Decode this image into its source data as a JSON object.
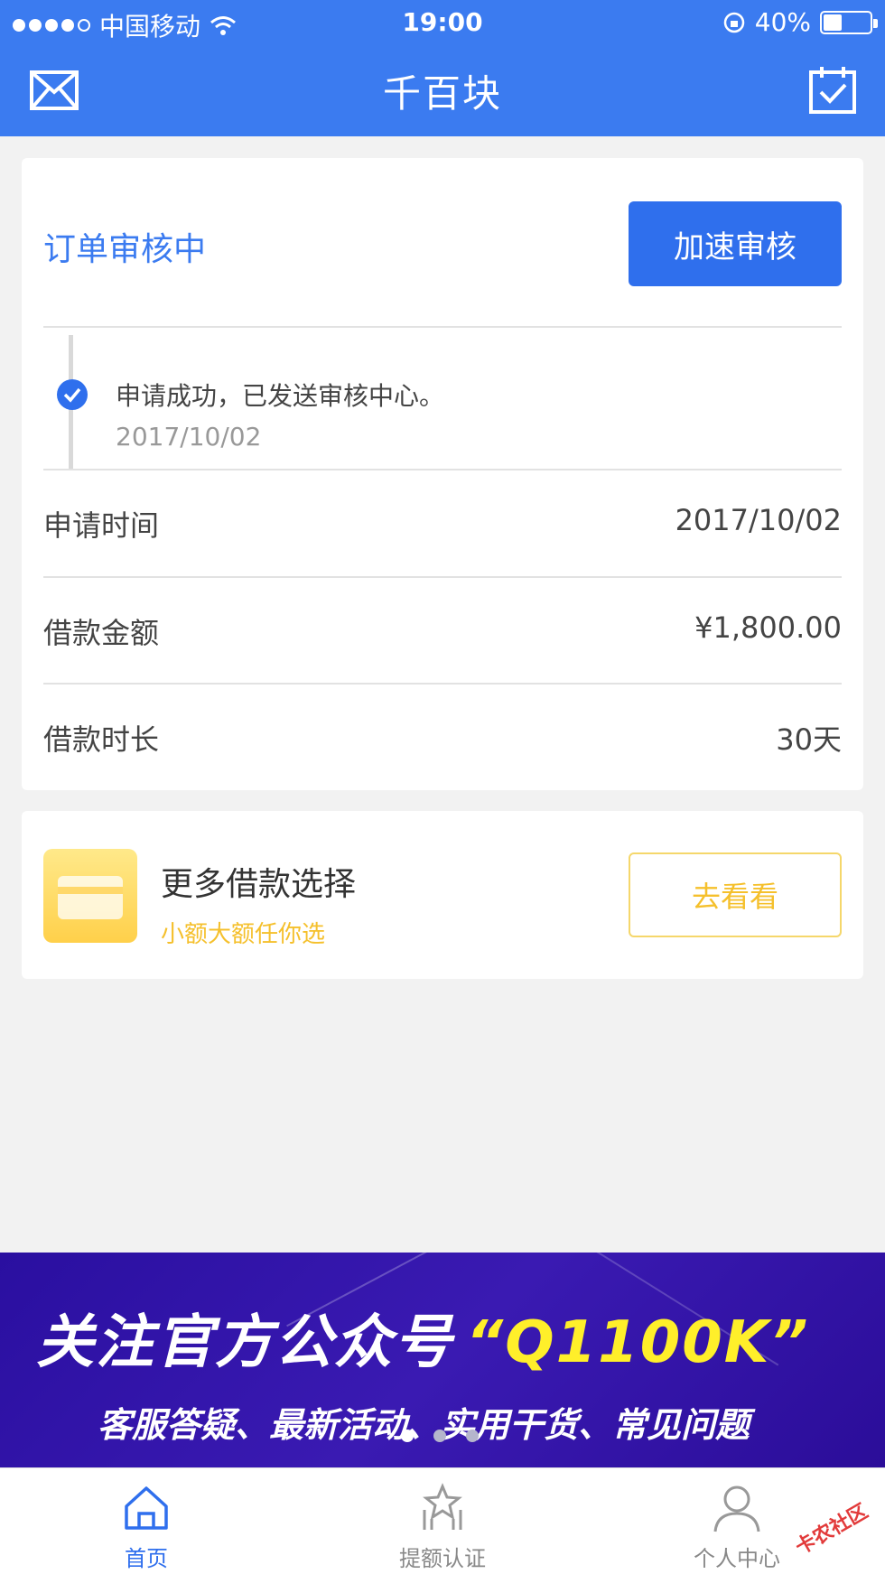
{
  "status_bar": {
    "carrier": "中国移动",
    "time": "19:00",
    "battery": "40%",
    "battery_level": 0.4
  },
  "nav": {
    "title": "千百块",
    "left_icon": "mail-icon",
    "right_icon": "calendar-check-icon"
  },
  "order": {
    "status": "订单审核中",
    "speed_button": "加速审核",
    "timeline": {
      "text": "申请成功，已发送审核中心。",
      "date": "2017/10/02"
    },
    "rows": [
      {
        "label": "申请时间",
        "value": "2017/10/02"
      },
      {
        "label": "借款金额",
        "value": "¥1,800.00"
      },
      {
        "label": "借款时长",
        "value": "30天"
      }
    ]
  },
  "more": {
    "title": "更多借款选择",
    "subtitle": "小额大额任你选",
    "button": "去看看"
  },
  "banner": {
    "line1": "关注官方公众号",
    "code": "“Q1100K”",
    "line2": "客服答疑、最新活动、实用干货、常见问题",
    "active_slide": 1,
    "slide_count": 3
  },
  "tabs": [
    {
      "label": "首页",
      "icon": "home-icon",
      "active": true
    },
    {
      "label": "提额认证",
      "icon": "star-badge-icon",
      "active": false
    },
    {
      "label": "个人中心",
      "icon": "person-icon",
      "active": false
    }
  ],
  "watermark": "卡农社区",
  "colors": {
    "primary": "#3b7bf0",
    "button": "#2f6fed",
    "accent_yellow": "#f5c02c",
    "banner": "#2a0fa0"
  }
}
